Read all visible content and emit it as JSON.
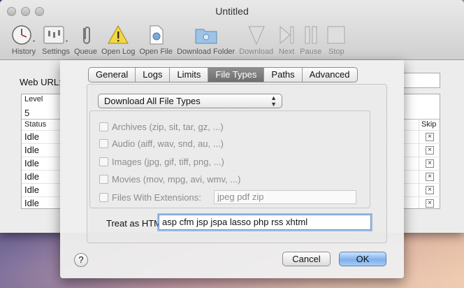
{
  "window": {
    "title": "Untitled"
  },
  "toolbar": {
    "items": [
      {
        "label": "History",
        "icon": "clock-icon"
      },
      {
        "label": "Settings",
        "icon": "settings-icon"
      },
      {
        "label": "Queue",
        "icon": "paperclip-icon"
      },
      {
        "label": "Open Log",
        "icon": "warning-icon"
      },
      {
        "label": "Open File",
        "icon": "file-icon"
      },
      {
        "label": "Download Folder",
        "icon": "folder-icon"
      },
      {
        "label": "Download",
        "icon": "download-arrow-icon"
      },
      {
        "label": "Next",
        "icon": "next-icon"
      },
      {
        "label": "Pause",
        "icon": "pause-icon"
      },
      {
        "label": "Stop",
        "icon": "stop-icon"
      }
    ]
  },
  "main": {
    "web_url_label": "Web URL:",
    "table": {
      "level_header": "Level",
      "level_value": "5",
      "status_header": "Status",
      "skip_header": "Skip",
      "rows": [
        "Idle",
        "Idle",
        "Idle",
        "Idle",
        "Idle",
        "Idle"
      ],
      "skip_mark": "×"
    }
  },
  "sheet": {
    "tabs": [
      "General",
      "Logs",
      "Limits",
      "File Types",
      "Paths",
      "Advanced"
    ],
    "active_tab": "File Types",
    "popup": {
      "value": "Download All File Types"
    },
    "checkboxes": [
      {
        "label": "Archives (zip, sit, tar, gz, ...)",
        "checked": false
      },
      {
        "label": "Audio (aiff, wav, snd, au, ...)",
        "checked": false
      },
      {
        "label": "Images (jpg, gif, tiff, png, ...)",
        "checked": false
      },
      {
        "label": "Movies (mov, mpg, avi, wmv, ...)",
        "checked": false
      },
      {
        "label": "Files With Extensions:",
        "checked": false
      }
    ],
    "extensions_value": "jpeg pdf zip",
    "treat_html_label": "Treat as HTML:",
    "treat_html_value": "asp cfm jsp jspa lasso php rss xhtml",
    "help_label": "?",
    "cancel_label": "Cancel",
    "ok_label": "OK",
    "colors": {
      "default_button": "#7fb0ec",
      "active_tab": "#7a7a7a"
    }
  }
}
